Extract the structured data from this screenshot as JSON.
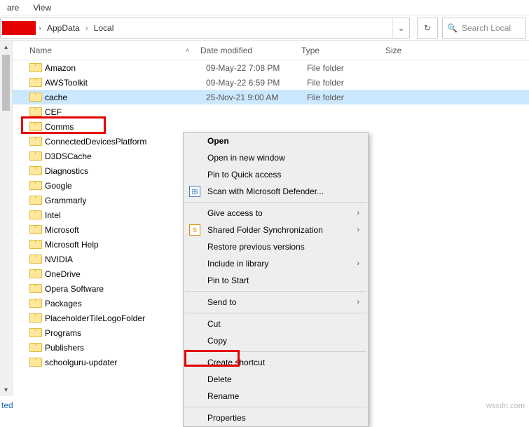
{
  "tabs": {
    "share": "are",
    "view": "View"
  },
  "breadcrumb": {
    "item1": "AppData",
    "item2": "Local"
  },
  "search": {
    "placeholder": "Search Local"
  },
  "columns": {
    "name": "Name",
    "date": "Date modified",
    "type": "Type",
    "size": "Size"
  },
  "files": [
    {
      "name": "Amazon",
      "date": "09-May-22 7:08 PM",
      "type": "File folder",
      "selected": false
    },
    {
      "name": "AWSToolkit",
      "date": "09-May-22 6:59 PM",
      "type": "File folder",
      "selected": false
    },
    {
      "name": "cache",
      "date": "25-Nov-21 9:00 AM",
      "type": "File folder",
      "selected": true
    },
    {
      "name": "CEF",
      "date": "",
      "type": "",
      "selected": false
    },
    {
      "name": "Comms",
      "date": "",
      "type": "",
      "selected": false
    },
    {
      "name": "ConnectedDevicesPlatform",
      "date": "",
      "type": "",
      "selected": false
    },
    {
      "name": "D3DSCache",
      "date": "",
      "type": "",
      "selected": false
    },
    {
      "name": "Diagnostics",
      "date": "",
      "type": "",
      "selected": false
    },
    {
      "name": "Google",
      "date": "",
      "type": "",
      "selected": false
    },
    {
      "name": "Grammarly",
      "date": "",
      "type": "",
      "selected": false
    },
    {
      "name": "Intel",
      "date": "",
      "type": "",
      "selected": false
    },
    {
      "name": "Microsoft",
      "date": "",
      "type": "",
      "selected": false
    },
    {
      "name": "Microsoft Help",
      "date": "",
      "type": "",
      "selected": false
    },
    {
      "name": "NVIDIA",
      "date": "",
      "type": "",
      "selected": false
    },
    {
      "name": "OneDrive",
      "date": "",
      "type": "",
      "selected": false
    },
    {
      "name": "Opera Software",
      "date": "",
      "type": "",
      "selected": false
    },
    {
      "name": "Packages",
      "date": "",
      "type": "",
      "selected": false
    },
    {
      "name": "PlaceholderTileLogoFolder",
      "date": "",
      "type": "",
      "selected": false
    },
    {
      "name": "Programs",
      "date": "",
      "type": "",
      "selected": false
    },
    {
      "name": "Publishers",
      "date": "",
      "type": "",
      "selected": false
    },
    {
      "name": "schoolguru-updater",
      "date": "",
      "type": "",
      "selected": false
    }
  ],
  "menu": {
    "open": "Open",
    "open_new": "Open in new window",
    "pin_quick": "Pin to Quick access",
    "defender": "Scan with Microsoft Defender...",
    "give_access": "Give access to",
    "sync": "Shared Folder Synchronization",
    "restore": "Restore previous versions",
    "include": "Include in library",
    "pin_start": "Pin to Start",
    "send_to": "Send to",
    "cut": "Cut",
    "copy": "Copy",
    "shortcut": "Create shortcut",
    "delete": "Delete",
    "rename": "Rename",
    "properties": "Properties"
  },
  "status": "ted",
  "watermark": "wsxdn.com"
}
